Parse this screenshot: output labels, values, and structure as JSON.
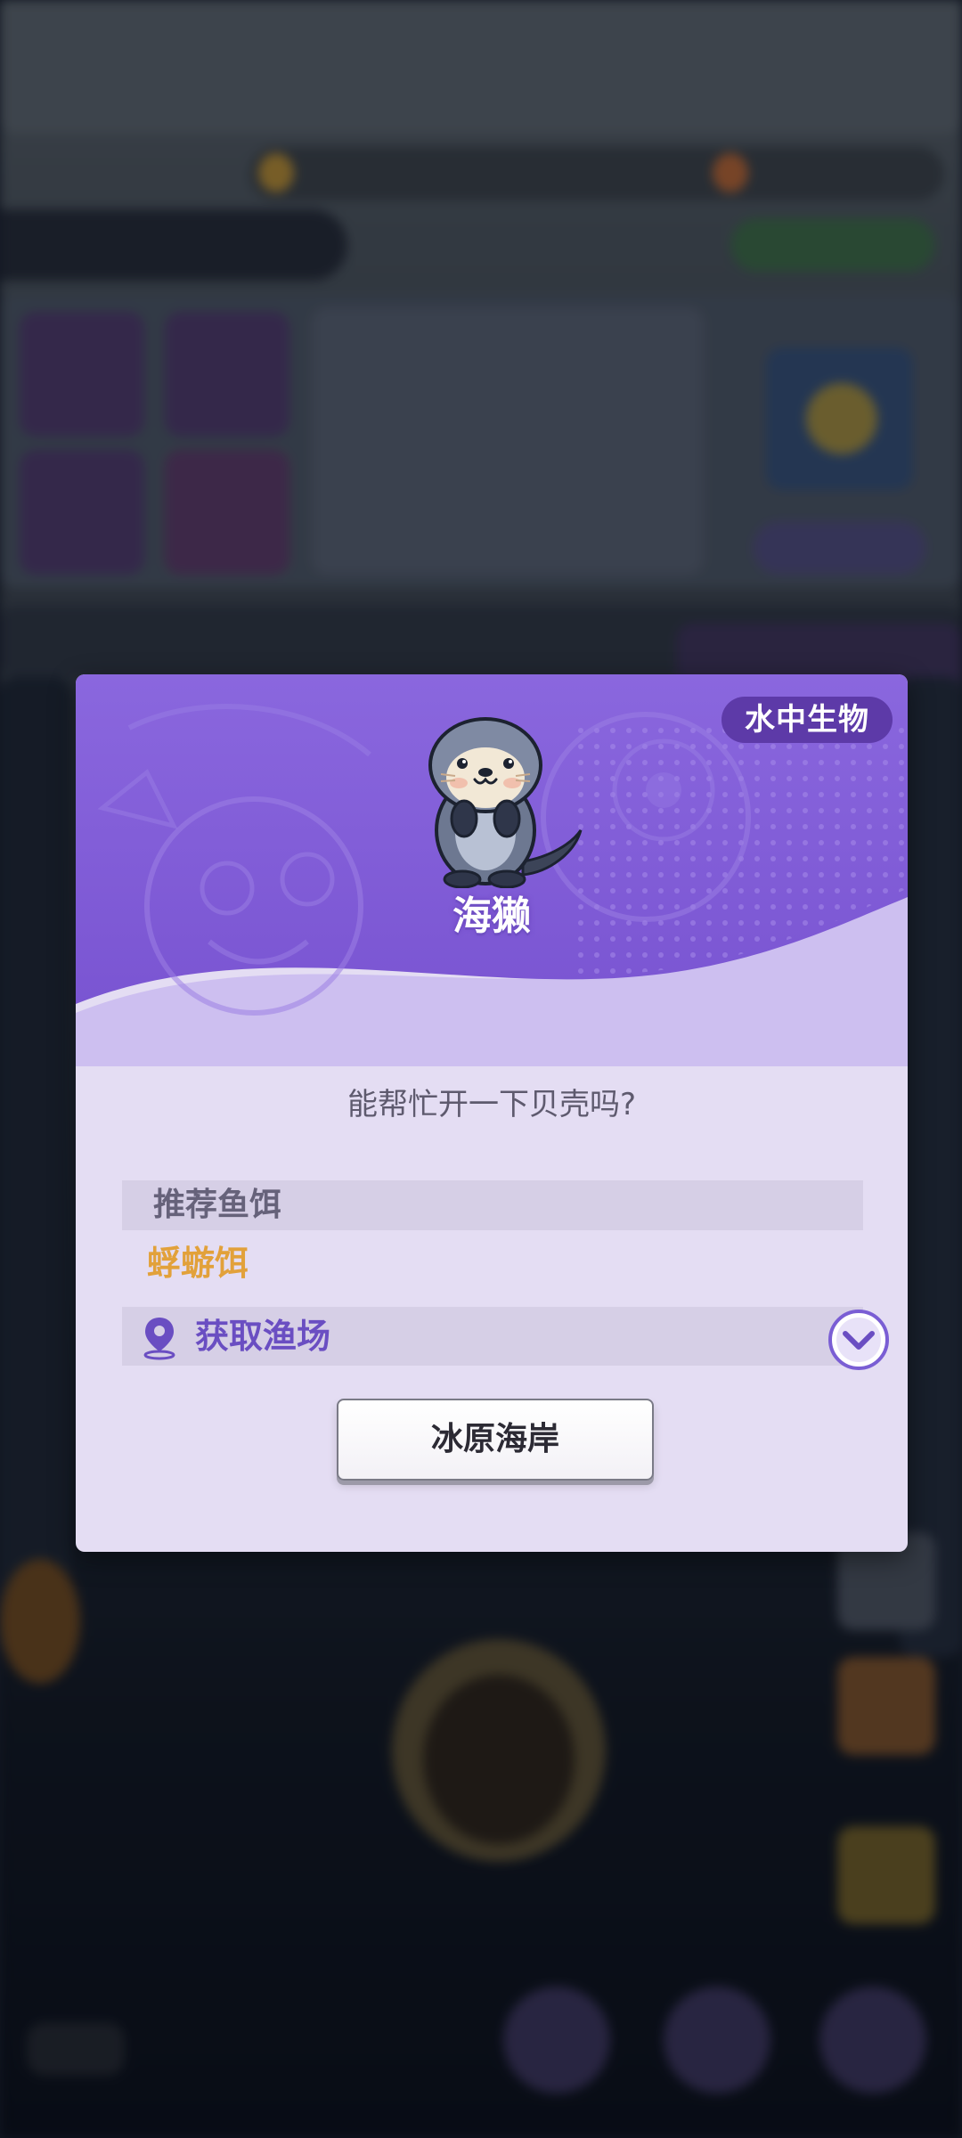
{
  "dialog": {
    "category_tag": "水中生物",
    "creature_name": "海獭",
    "dialogue": "能帮忙开一下贝壳吗?",
    "bait_title": "推荐鱼饵",
    "bait_value": "蜉蝣饵",
    "fishery_label": "获取渔场",
    "location_button": "冰原海岸"
  },
  "icons": {
    "creature": "sea-otter-icon",
    "location": "map-pin-icon",
    "expand": "chevron-down-icon"
  },
  "colors": {
    "header_purple": "#7c59d6",
    "body_lavender": "#e4ddf3",
    "tag_bg": "#5d3aa8",
    "bait_orange": "#e2a13a",
    "fishery_purple": "#6a4ec2"
  }
}
